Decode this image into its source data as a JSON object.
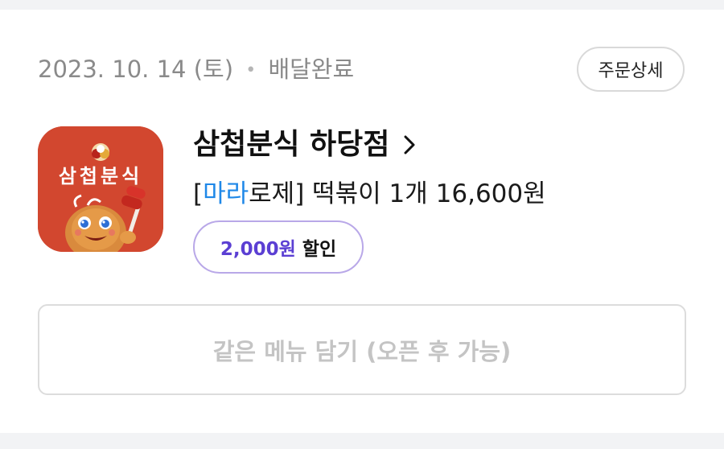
{
  "order": {
    "date": "2023. 10. 14 (토)",
    "separator": "•",
    "status": "배달완료",
    "detail_button": "주문상세"
  },
  "store": {
    "name": "삼첩분식 하당점",
    "logo_text": "삼첩분식",
    "chevron_icon": "chevron-right-icon"
  },
  "item": {
    "bracket_open": "[",
    "highlight": "마라",
    "rest": "로제] 떡볶이 1개 16,600원"
  },
  "discount": {
    "amount": "2,000원",
    "label": "할인"
  },
  "reorder_button": "같은 메뉴 담기 (오픈 후 가능)",
  "colors": {
    "logo_bg": "#d2472f",
    "discount_accent": "#5b3fd3",
    "highlight_blue": "#1f88e8"
  }
}
